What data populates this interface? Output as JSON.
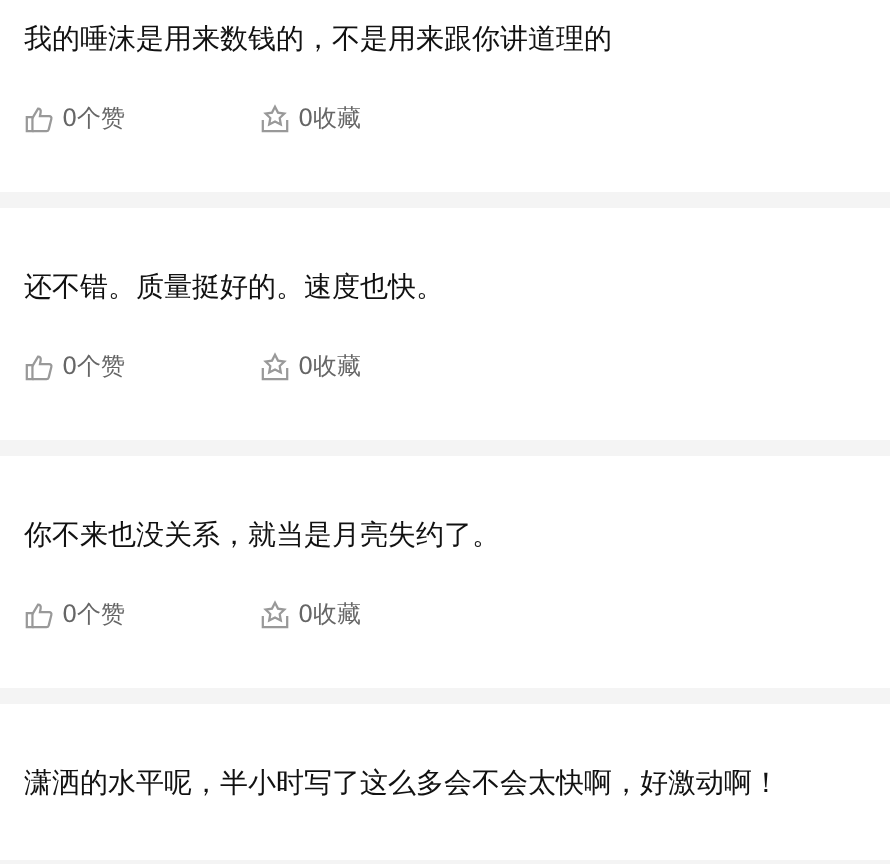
{
  "posts": [
    {
      "text": "我的唾沫是用来数钱的，不是用来跟你讲道理的",
      "likes": "0个赞",
      "favorites": "0收藏"
    },
    {
      "text": "还不错。质量挺好的。速度也快。",
      "likes": "0个赞",
      "favorites": "0收藏"
    },
    {
      "text": "你不来也没关系，就当是月亮失约了。",
      "likes": "0个赞",
      "favorites": "0收藏"
    },
    {
      "text": "潇洒的水平呢，半小时写了这么多会不会太快啊，好激动啊！"
    }
  ]
}
